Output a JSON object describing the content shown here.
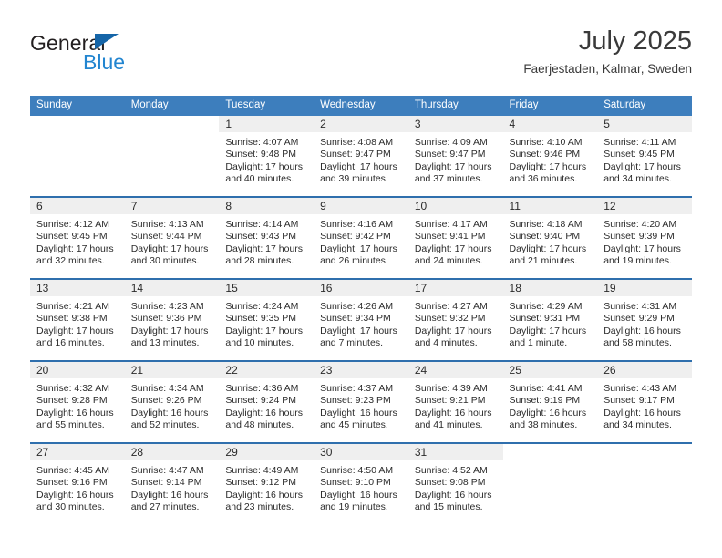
{
  "logo": {
    "word_one": "General",
    "word_two": "Blue",
    "triangle_color": "#1565a8",
    "blue_color": "#2285d0"
  },
  "header": {
    "title": "July 2025",
    "location": "Faerjestaden, Kalmar, Sweden"
  },
  "theme": {
    "header_blue": "#3d7ebd",
    "separator_blue": "#2f6fad",
    "daynum_band": "#efefef"
  },
  "weekdays": [
    "Sunday",
    "Monday",
    "Tuesday",
    "Wednesday",
    "Thursday",
    "Friday",
    "Saturday"
  ],
  "weeks": [
    [
      {
        "day": "",
        "blank": true,
        "sunrise": "",
        "sunset": "",
        "daylight": ""
      },
      {
        "day": "",
        "blank": true,
        "sunrise": "",
        "sunset": "",
        "daylight": ""
      },
      {
        "day": "1",
        "sunrise": "Sunrise: 4:07 AM",
        "sunset": "Sunset: 9:48 PM",
        "daylight": "Daylight: 17 hours and 40 minutes."
      },
      {
        "day": "2",
        "sunrise": "Sunrise: 4:08 AM",
        "sunset": "Sunset: 9:47 PM",
        "daylight": "Daylight: 17 hours and 39 minutes."
      },
      {
        "day": "3",
        "sunrise": "Sunrise: 4:09 AM",
        "sunset": "Sunset: 9:47 PM",
        "daylight": "Daylight: 17 hours and 37 minutes."
      },
      {
        "day": "4",
        "sunrise": "Sunrise: 4:10 AM",
        "sunset": "Sunset: 9:46 PM",
        "daylight": "Daylight: 17 hours and 36 minutes."
      },
      {
        "day": "5",
        "sunrise": "Sunrise: 4:11 AM",
        "sunset": "Sunset: 9:45 PM",
        "daylight": "Daylight: 17 hours and 34 minutes."
      }
    ],
    [
      {
        "day": "6",
        "sunrise": "Sunrise: 4:12 AM",
        "sunset": "Sunset: 9:45 PM",
        "daylight": "Daylight: 17 hours and 32 minutes."
      },
      {
        "day": "7",
        "sunrise": "Sunrise: 4:13 AM",
        "sunset": "Sunset: 9:44 PM",
        "daylight": "Daylight: 17 hours and 30 minutes."
      },
      {
        "day": "8",
        "sunrise": "Sunrise: 4:14 AM",
        "sunset": "Sunset: 9:43 PM",
        "daylight": "Daylight: 17 hours and 28 minutes."
      },
      {
        "day": "9",
        "sunrise": "Sunrise: 4:16 AM",
        "sunset": "Sunset: 9:42 PM",
        "daylight": "Daylight: 17 hours and 26 minutes."
      },
      {
        "day": "10",
        "sunrise": "Sunrise: 4:17 AM",
        "sunset": "Sunset: 9:41 PM",
        "daylight": "Daylight: 17 hours and 24 minutes."
      },
      {
        "day": "11",
        "sunrise": "Sunrise: 4:18 AM",
        "sunset": "Sunset: 9:40 PM",
        "daylight": "Daylight: 17 hours and 21 minutes."
      },
      {
        "day": "12",
        "sunrise": "Sunrise: 4:20 AM",
        "sunset": "Sunset: 9:39 PM",
        "daylight": "Daylight: 17 hours and 19 minutes."
      }
    ],
    [
      {
        "day": "13",
        "sunrise": "Sunrise: 4:21 AM",
        "sunset": "Sunset: 9:38 PM",
        "daylight": "Daylight: 17 hours and 16 minutes."
      },
      {
        "day": "14",
        "sunrise": "Sunrise: 4:23 AM",
        "sunset": "Sunset: 9:36 PM",
        "daylight": "Daylight: 17 hours and 13 minutes."
      },
      {
        "day": "15",
        "sunrise": "Sunrise: 4:24 AM",
        "sunset": "Sunset: 9:35 PM",
        "daylight": "Daylight: 17 hours and 10 minutes."
      },
      {
        "day": "16",
        "sunrise": "Sunrise: 4:26 AM",
        "sunset": "Sunset: 9:34 PM",
        "daylight": "Daylight: 17 hours and 7 minutes."
      },
      {
        "day": "17",
        "sunrise": "Sunrise: 4:27 AM",
        "sunset": "Sunset: 9:32 PM",
        "daylight": "Daylight: 17 hours and 4 minutes."
      },
      {
        "day": "18",
        "sunrise": "Sunrise: 4:29 AM",
        "sunset": "Sunset: 9:31 PM",
        "daylight": "Daylight: 17 hours and 1 minute."
      },
      {
        "day": "19",
        "sunrise": "Sunrise: 4:31 AM",
        "sunset": "Sunset: 9:29 PM",
        "daylight": "Daylight: 16 hours and 58 minutes."
      }
    ],
    [
      {
        "day": "20",
        "sunrise": "Sunrise: 4:32 AM",
        "sunset": "Sunset: 9:28 PM",
        "daylight": "Daylight: 16 hours and 55 minutes."
      },
      {
        "day": "21",
        "sunrise": "Sunrise: 4:34 AM",
        "sunset": "Sunset: 9:26 PM",
        "daylight": "Daylight: 16 hours and 52 minutes."
      },
      {
        "day": "22",
        "sunrise": "Sunrise: 4:36 AM",
        "sunset": "Sunset: 9:24 PM",
        "daylight": "Daylight: 16 hours and 48 minutes."
      },
      {
        "day": "23",
        "sunrise": "Sunrise: 4:37 AM",
        "sunset": "Sunset: 9:23 PM",
        "daylight": "Daylight: 16 hours and 45 minutes."
      },
      {
        "day": "24",
        "sunrise": "Sunrise: 4:39 AM",
        "sunset": "Sunset: 9:21 PM",
        "daylight": "Daylight: 16 hours and 41 minutes."
      },
      {
        "day": "25",
        "sunrise": "Sunrise: 4:41 AM",
        "sunset": "Sunset: 9:19 PM",
        "daylight": "Daylight: 16 hours and 38 minutes."
      },
      {
        "day": "26",
        "sunrise": "Sunrise: 4:43 AM",
        "sunset": "Sunset: 9:17 PM",
        "daylight": "Daylight: 16 hours and 34 minutes."
      }
    ],
    [
      {
        "day": "27",
        "sunrise": "Sunrise: 4:45 AM",
        "sunset": "Sunset: 9:16 PM",
        "daylight": "Daylight: 16 hours and 30 minutes."
      },
      {
        "day": "28",
        "sunrise": "Sunrise: 4:47 AM",
        "sunset": "Sunset: 9:14 PM",
        "daylight": "Daylight: 16 hours and 27 minutes."
      },
      {
        "day": "29",
        "sunrise": "Sunrise: 4:49 AM",
        "sunset": "Sunset: 9:12 PM",
        "daylight": "Daylight: 16 hours and 23 minutes."
      },
      {
        "day": "30",
        "sunrise": "Sunrise: 4:50 AM",
        "sunset": "Sunset: 9:10 PM",
        "daylight": "Daylight: 16 hours and 19 minutes."
      },
      {
        "day": "31",
        "sunrise": "Sunrise: 4:52 AM",
        "sunset": "Sunset: 9:08 PM",
        "daylight": "Daylight: 16 hours and 15 minutes."
      },
      {
        "day": "",
        "blank": true,
        "sunrise": "",
        "sunset": "",
        "daylight": ""
      },
      {
        "day": "",
        "blank": true,
        "sunrise": "",
        "sunset": "",
        "daylight": ""
      }
    ]
  ]
}
